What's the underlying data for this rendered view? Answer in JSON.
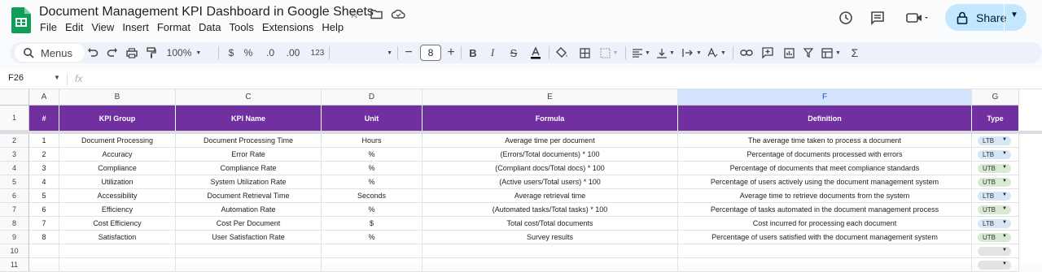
{
  "app": {
    "title": "Document Management KPI Dashboard in Google Sheets",
    "menus": [
      "File",
      "Edit",
      "View",
      "Insert",
      "Format",
      "Data",
      "Tools",
      "Extensions",
      "Help"
    ],
    "share_label": "Share"
  },
  "toolbar": {
    "menus_label": "Menus",
    "zoom": "100%",
    "currency": "$",
    "percent": "%",
    "dec_decrease": ".0",
    "dec_increase": ".00",
    "number_format": "123",
    "font_size": "8"
  },
  "formula_bar": {
    "cell_ref": "F26",
    "fx": "fx"
  },
  "sheet": {
    "columns": [
      "A",
      "B",
      "C",
      "D",
      "E",
      "F",
      "G"
    ],
    "selected_column": "F",
    "row_numbers": [
      "1",
      "2",
      "3",
      "4",
      "5",
      "6",
      "7",
      "8",
      "9",
      "10",
      "11"
    ],
    "headers": [
      "#",
      "KPI Group",
      "KPI Name",
      "Unit",
      "Formula",
      "Definition",
      "Type"
    ],
    "rows": [
      [
        "1",
        "Document Processing",
        "Document Processing Time",
        "Hours",
        "Average time per document",
        "The average time taken to process a document",
        "LTB"
      ],
      [
        "2",
        "Accuracy",
        "Error Rate",
        "%",
        "(Errors/Total documents) * 100",
        "Percentage of documents processed with errors",
        "LTB"
      ],
      [
        "3",
        "Compliance",
        "Compliance Rate",
        "%",
        "(Compliant docs/Total docs) * 100",
        "Percentage of documents that meet compliance standards",
        "UTB"
      ],
      [
        "4",
        "Utilization",
        "System Utilization Rate",
        "%",
        "(Active users/Total users) * 100",
        "Percentage of users actively using the document management system",
        "UTB"
      ],
      [
        "5",
        "Accessibility",
        "Document Retrieval Time",
        "Seconds",
        "Average retrieval time",
        "Average time to retrieve documents from the system",
        "LTB"
      ],
      [
        "6",
        "Efficiency",
        "Automation Rate",
        "%",
        "(Automated tasks/Total tasks) * 100",
        "Percentage of tasks automated in the document management process",
        "UTB"
      ],
      [
        "7",
        "Cost Efficiency",
        "Cost Per Document",
        "$",
        "Total cost/Total documents",
        "Cost incurred for processing each document",
        "LTB"
      ],
      [
        "8",
        "Satisfaction",
        "User Satisfaction Rate",
        "%",
        "Survey results",
        "Percentage of users satisfied with the document management system",
        "UTB"
      ],
      [
        "",
        "",
        "",
        "",
        "",
        "",
        ""
      ],
      [
        "",
        "",
        "",
        "",
        "",
        "",
        ""
      ]
    ]
  },
  "colors": {
    "header_fill": "#7030a0",
    "ltb_chip": "#d5e6f5",
    "utb_chip": "#d9ead3",
    "share_button": "#c2e7ff"
  }
}
